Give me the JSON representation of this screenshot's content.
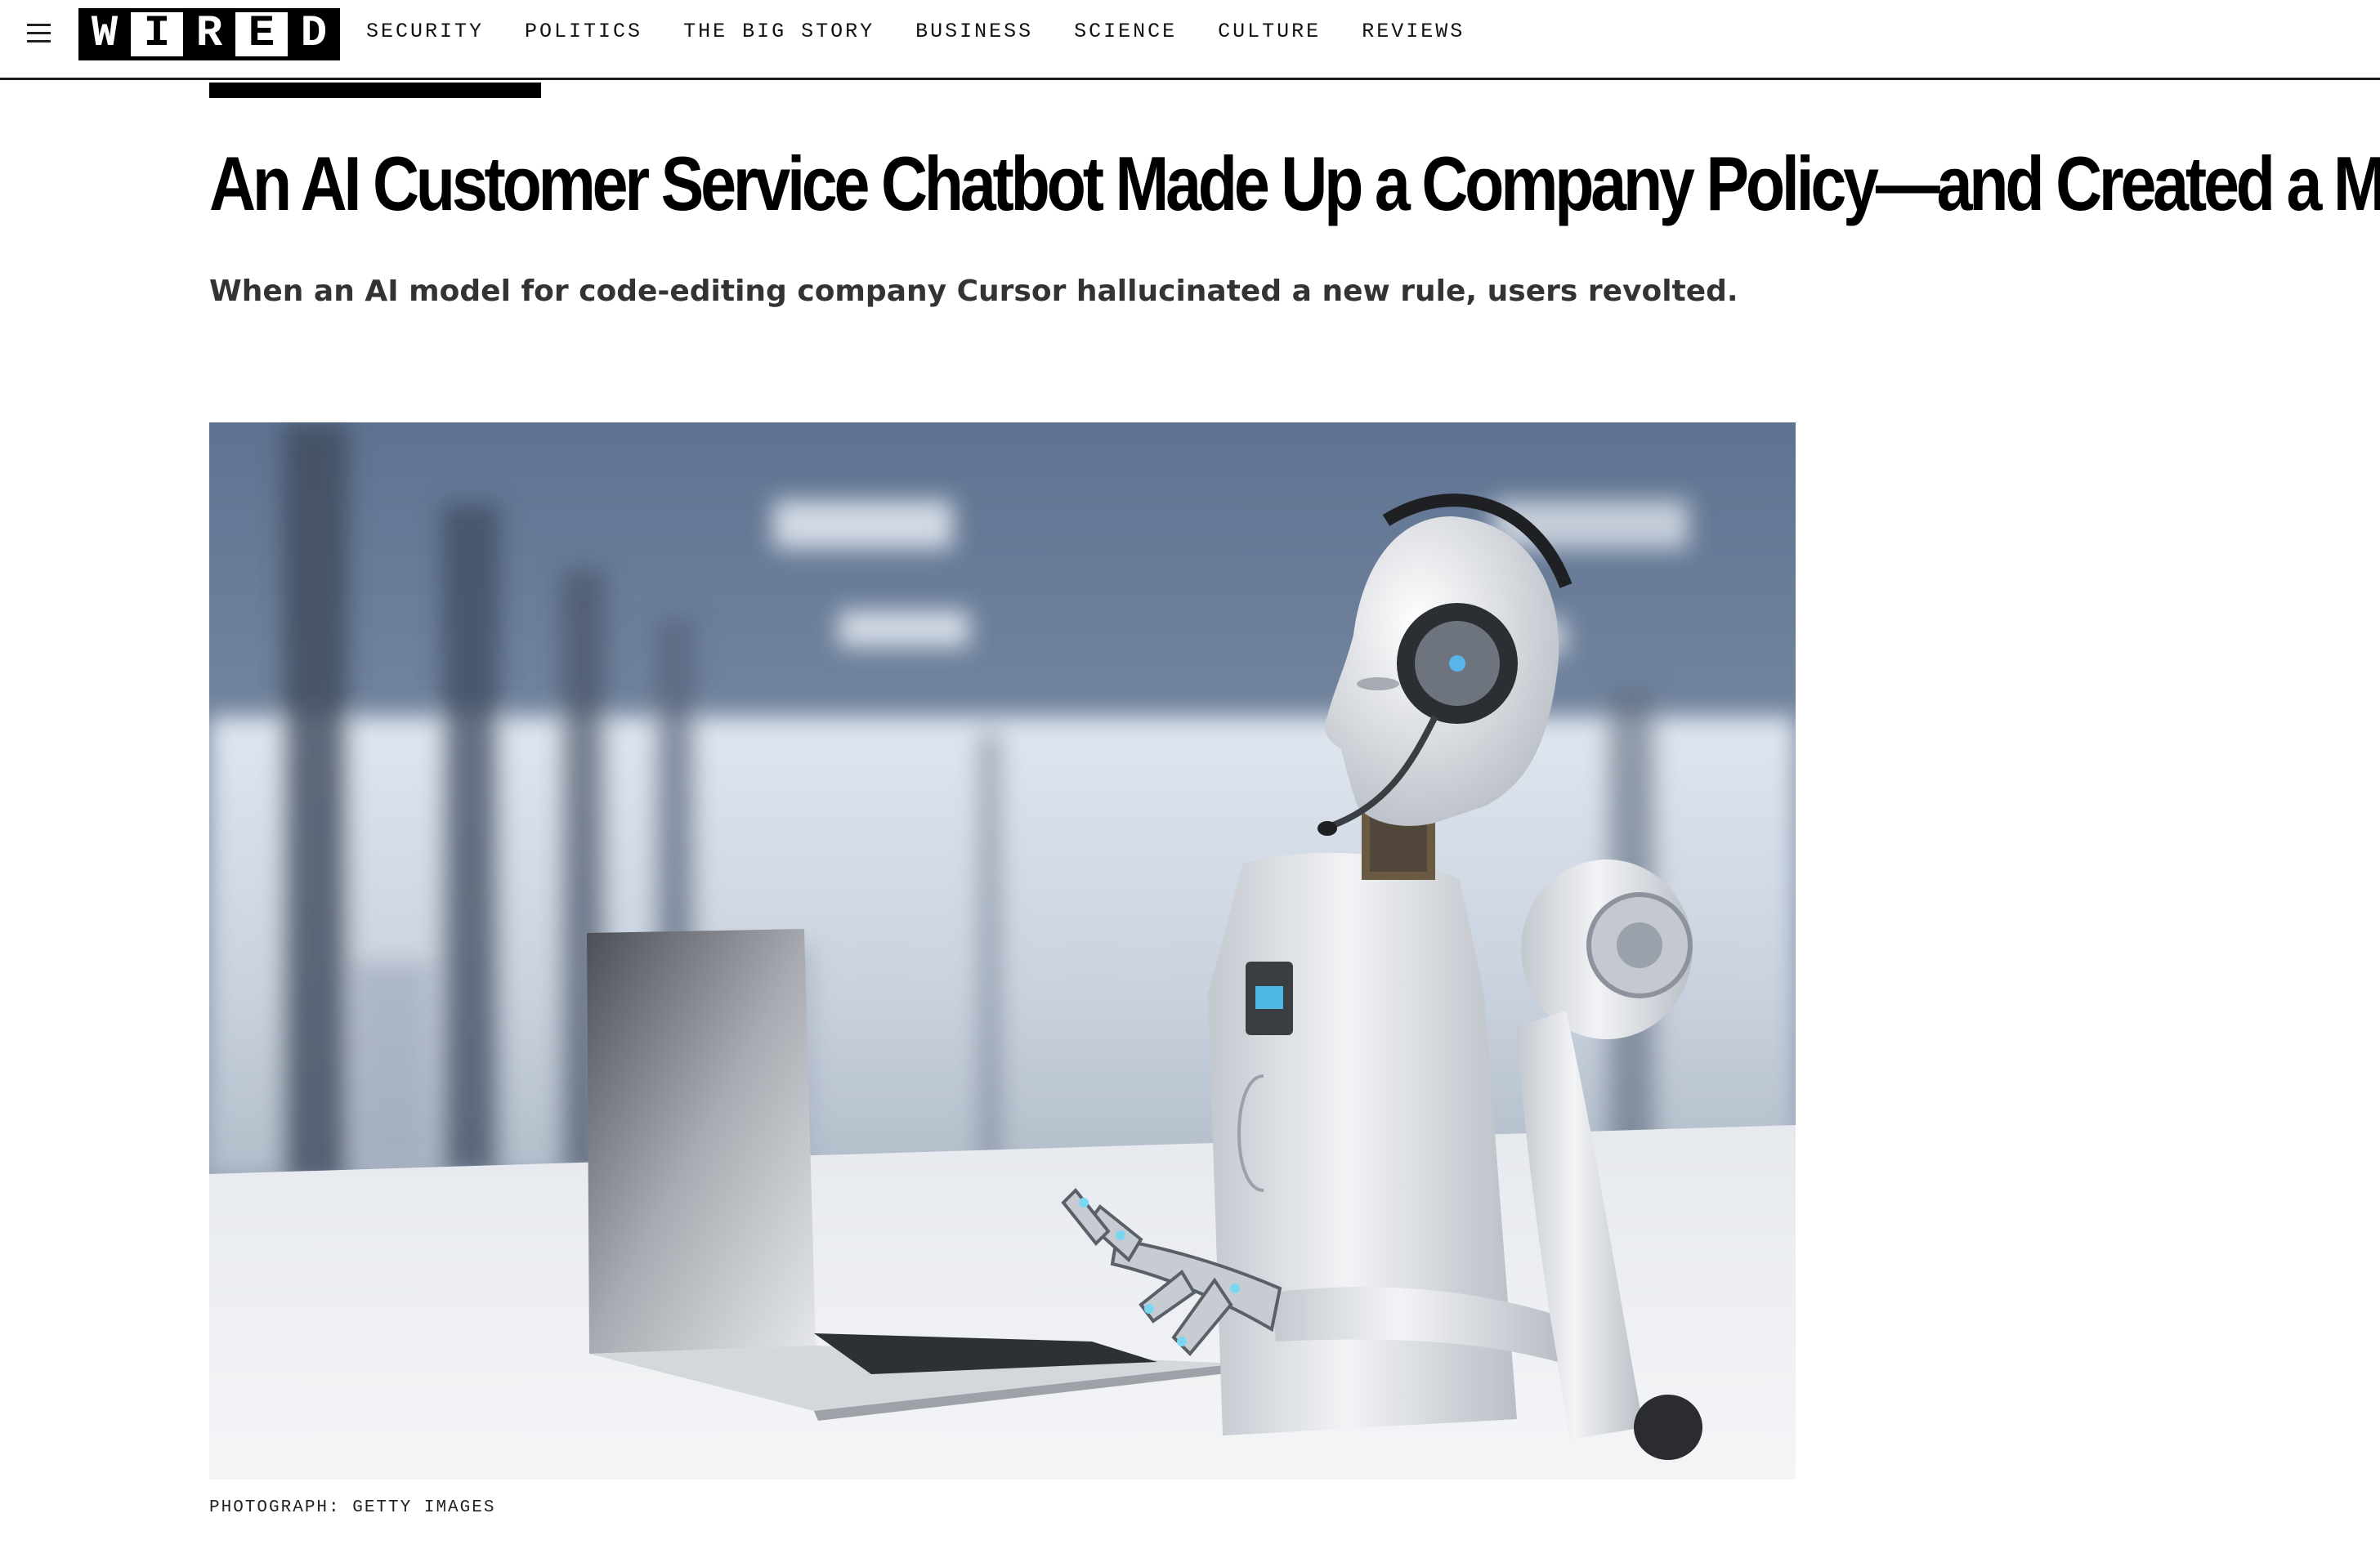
{
  "nav": {
    "logo_letters": [
      "W",
      "I",
      "R",
      "E",
      "D"
    ],
    "links": [
      "SECURITY",
      "POLITICS",
      "THE BIG STORY",
      "BUSINESS",
      "SCIENCE",
      "CULTURE",
      "REVIEWS"
    ]
  },
  "article": {
    "headline": "An AI Customer Service Chatbot Made Up a Company Policy—and Created a Mess",
    "dek": "When an AI model for code-editing company Cursor hallucinated a new rule, users revolted.",
    "hero_image": {
      "subject": "humanoid-robot-with-headset-typing-on-laptop",
      "credit": "PHOTOGRAPH: GETTY IMAGES"
    }
  },
  "colors": {
    "text": "#000000",
    "dek": "#333333",
    "rule": "#1a1a1a"
  }
}
